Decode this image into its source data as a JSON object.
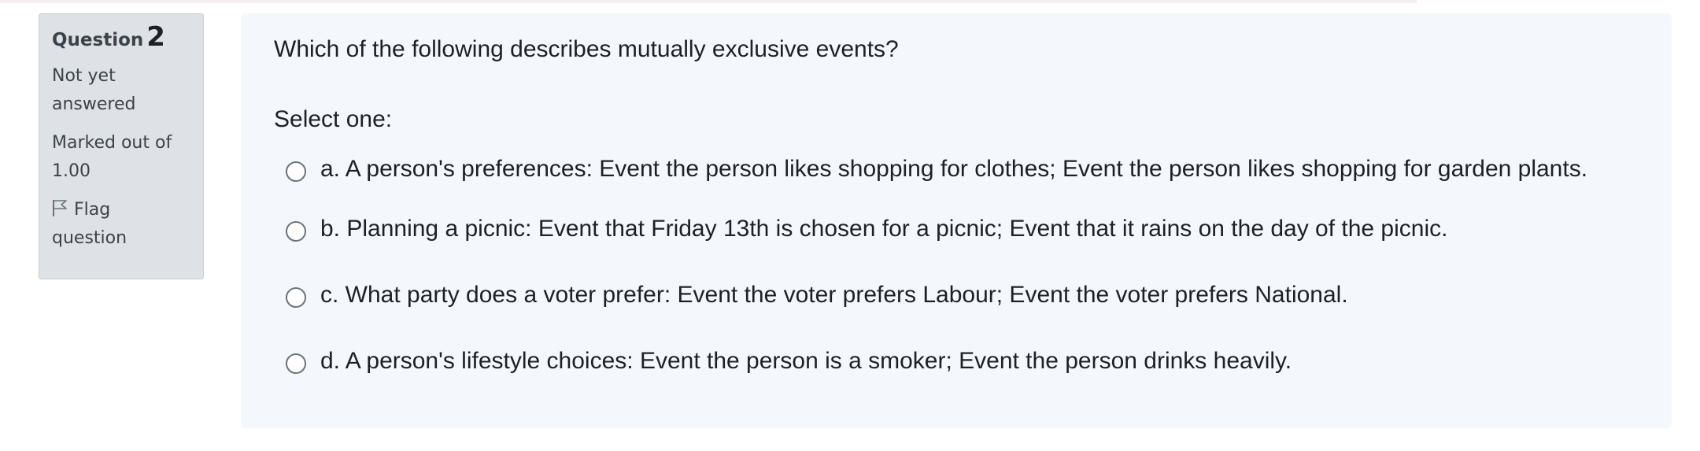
{
  "info": {
    "question_label": "Question",
    "question_number": "2",
    "state": "Not yet answered",
    "grade": "Marked out of 1.00",
    "flag_label": "Flag question"
  },
  "question": {
    "text": "Which of the following describes mutually exclusive events?",
    "prompt": "Select one:",
    "answers": [
      {
        "label": "a. A person's preferences: Event the person likes shopping for clothes; Event the person likes shopping for garden plants.",
        "selected": false
      },
      {
        "label": "b. Planning a picnic: Event that Friday 13th is chosen for a picnic; Event that it rains on the day of the picnic.",
        "selected": false
      },
      {
        "label": "c. What party does a voter prefer: Event the voter prefers Labour; Event the voter prefers National.",
        "selected": false
      },
      {
        "label": "d. A person's lifestyle choices: Event the person is a smoker; Event the person drinks heavily.",
        "selected": false
      }
    ]
  },
  "colors": {
    "info_background": "#dee2e6",
    "content_background": "#f4f7fc",
    "text": "#1d2125"
  }
}
